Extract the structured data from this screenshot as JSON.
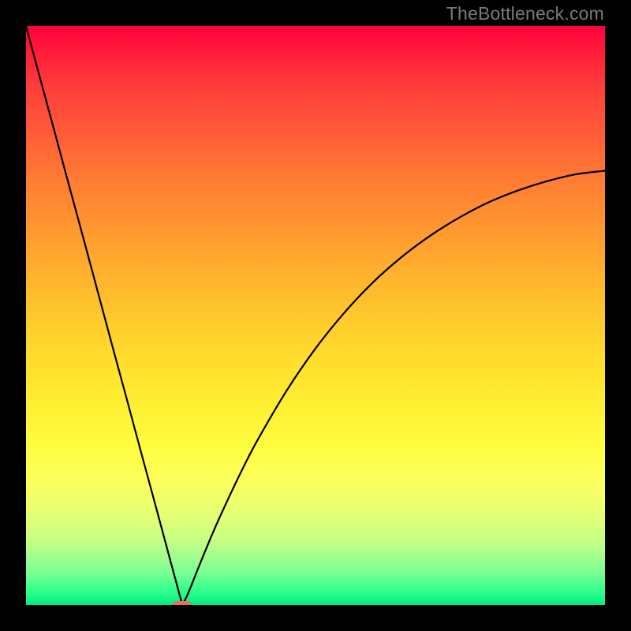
{
  "watermark": "TheBottleneck.com",
  "chart_data": {
    "type": "line",
    "title": "",
    "xlabel": "",
    "ylabel": "",
    "xlim": [
      0,
      100
    ],
    "ylim": [
      0,
      100
    ],
    "grid": false,
    "legend": false,
    "description": "Bottleneck percentage curve. V-shaped curve reaching minimum (0%) near x≈27, rising steeply to ~100% toward x=0 and slowly approaching ~75% toward x=100.",
    "series": [
      {
        "name": "bottleneck-curve",
        "x": [
          0.0,
          2.5,
          5.0,
          7.5,
          10.0,
          12.5,
          15.0,
          17.5,
          20.0,
          22.5,
          25.0,
          26.0,
          27.0,
          28.0,
          30.0,
          32.5,
          35.0,
          37.5,
          40.0,
          45.0,
          50.0,
          55.0,
          60.0,
          65.0,
          70.0,
          75.0,
          80.0,
          85.0,
          90.0,
          95.0,
          100.0
        ],
        "y": [
          100.0,
          90.7,
          81.5,
          72.2,
          63.0,
          53.7,
          44.4,
          35.2,
          25.9,
          16.7,
          7.4,
          3.7,
          0.0,
          2.0,
          7.0,
          13.0,
          18.5,
          23.7,
          28.5,
          37.0,
          44.3,
          50.5,
          55.8,
          60.2,
          63.9,
          67.0,
          69.6,
          71.6,
          73.2,
          74.4,
          75.0
        ]
      }
    ],
    "marker": {
      "x": 27.0,
      "y": 0.0,
      "color": "#ed6a66"
    }
  }
}
